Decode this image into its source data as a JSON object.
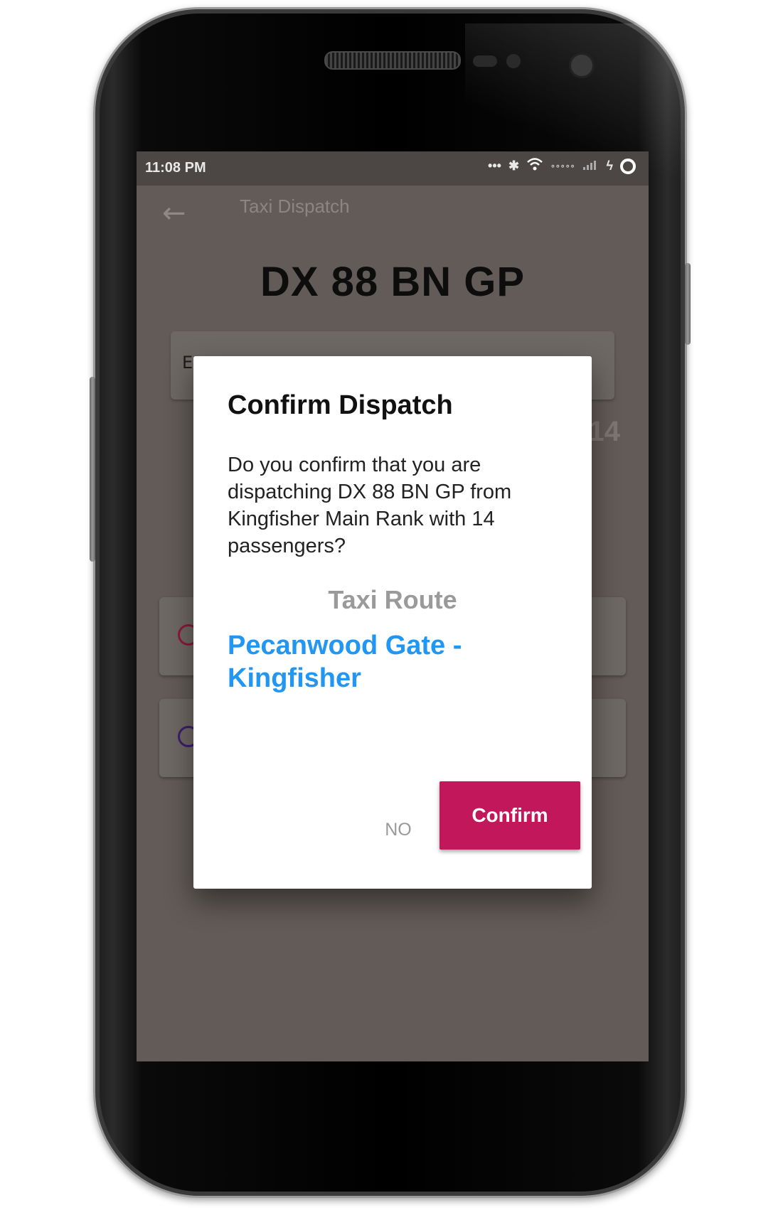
{
  "status_bar": {
    "time": "11:08 PM",
    "icons": [
      "more-dots-icon",
      "bluetooth-icon",
      "wifi-icon",
      "signal-icon",
      "charging-icon",
      "battery-ring-icon"
    ]
  },
  "app_bar": {
    "title": "Taxi Dispatch",
    "back_icon": "arrow-left-icon"
  },
  "background": {
    "plate": "DX 88 BN GP",
    "field_initial": "E",
    "passenger_count": "14",
    "card_icon_colors": [
      "#8b1a3a",
      "#3c1e6e"
    ]
  },
  "dialog": {
    "title": "Confirm Dispatch",
    "message": "Do you confirm that you are dispatching DX 88 BN GP from Kingfisher Main Rank with 14 passengers?",
    "route_label": "Taxi Route",
    "route_name": "Pecanwood Gate - Kingfisher",
    "no_label": "NO",
    "confirm_label": "Confirm"
  },
  "colors": {
    "accent": "#c2185b",
    "link": "#2196f3"
  }
}
